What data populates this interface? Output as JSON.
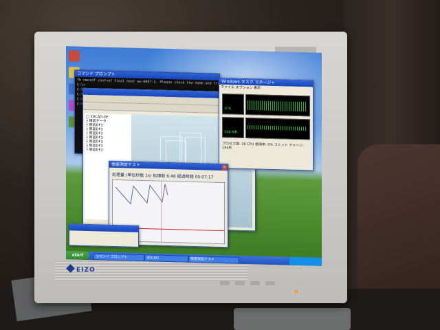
{
  "scene": "photo of CRT-style LCD monitor showing Windows XP desktop",
  "monitor": {
    "brand": "EIZO"
  },
  "console": {
    "title": "コマンド プロンプト",
    "lines": [
      "Th nmosdf conf>of final host ww-0007-1. Please check the name and try aga",
      "C:\\>",
      "C:\\>",
      "C:\\>",
      "C:\\>",
      "C:\\>"
    ]
  },
  "cad": {
    "title": "",
    "tree": [
      "□ 3DCAD-DF",
      "├ 確認データ",
      "├ 部品DF3",
      "├ 部品DF3",
      "├ 部品DF3",
      "├ 部品DF3",
      "├ 部品DF3",
      "├ 部品DF3",
      "└ 部品DF3"
    ]
  },
  "taskmanager": {
    "title": "Windows タスク マネージャ",
    "tabs": "ファイル オプション 表示",
    "cpu_label": "CPU 使用率",
    "cpu_value": "0 %",
    "pf_label": "PF 使用量",
    "pf_value": "144 MB",
    "footer": "プロセス数: 36 CPU 使用率: 0% コミット チャージ: 144M"
  },
  "monitorwin": {
    "title": "性能測定テスト",
    "head": "処理量  (単位秒数  1s)    処理数    6:48 経過時間 00:07:17"
  },
  "taskbar": {
    "start": "start",
    "items": [
      "コマンド プロンプト",
      "3DCAD",
      "性能測定テスト"
    ],
    "clock": ""
  }
}
